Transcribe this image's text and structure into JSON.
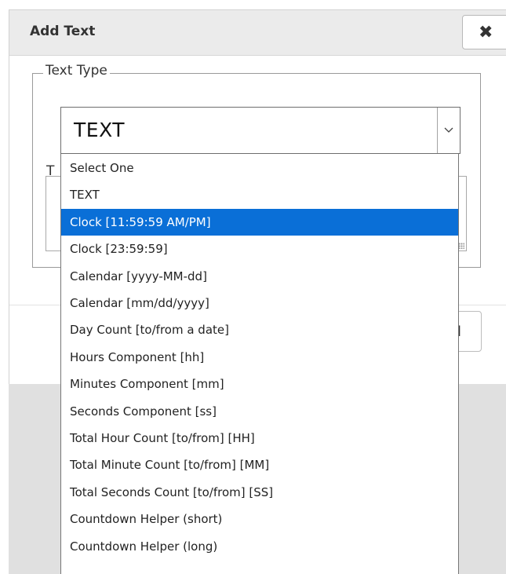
{
  "dialog": {
    "title": "Add Text",
    "close_glyph": "✖",
    "close_icon": "close-icon"
  },
  "fieldset": {
    "legend": "Text Type",
    "second_legend_fragment": "T"
  },
  "select": {
    "value": "TEXT",
    "arrow_icon": "chevron-down-icon"
  },
  "dropdown": {
    "highlighted_index": 2,
    "highlight_color": "#0a6fd7",
    "options": [
      "Select One",
      "TEXT",
      "Clock [11:59:59 AM/PM]",
      "Clock [23:59:59]",
      "Calendar [yyyy-MM-dd]",
      "Calendar [mm/dd/yyyy]",
      "Day Count [to/from a date]",
      "Hours Component [hh]",
      "Minutes Component [mm]",
      "Seconds Component [ss]",
      "Total Hour Count [to/from] [HH]",
      "Total Minute Count [to/from] [MM]",
      "Total Seconds Count [to/from] [SS]",
      "Countdown Helper (short)",
      "Countdown Helper (long)"
    ]
  },
  "footer": {
    "cancel_fragment": "el"
  }
}
